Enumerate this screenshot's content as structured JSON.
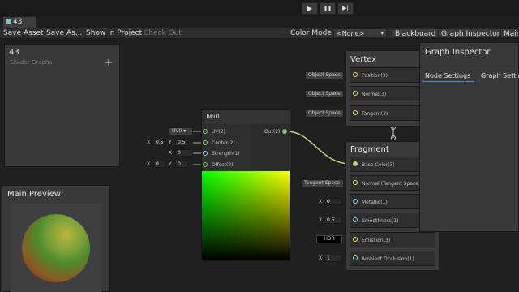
{
  "window": {
    "tab_title": "43"
  },
  "playbar": {
    "play": "▶",
    "pause": "❚❚",
    "step": "▶|"
  },
  "toolbar": {
    "save_asset": "Save Asset",
    "save_as": "Save As...",
    "show_in_project": "Show In Project",
    "check_out": "Check Out",
    "color_mode_label": "Color Mode",
    "color_mode_value": "<None>",
    "blackboard": "Blackboard",
    "graph_inspector": "Graph Inspector",
    "main": "Main"
  },
  "blackboard": {
    "title": "43",
    "subtitle": "Shader Graphs",
    "add": "+"
  },
  "main_preview": {
    "title": "Main Preview"
  },
  "twirl_node": {
    "title": "Twirl",
    "inputs": [
      "UV(2)",
      "Center(2)",
      "Strength(1)",
      "Offset(2)"
    ],
    "output": "Out(2)",
    "uv_value": "UV0 ▾",
    "center": {
      "x_label": "X",
      "x": "0.5",
      "y_label": "Y",
      "y": "0.5"
    },
    "strength": {
      "x_label": "X",
      "x": "0"
    },
    "offset": {
      "x_label": "X",
      "x": "0",
      "y_label": "Y",
      "y": "0"
    }
  },
  "vertex": {
    "title": "Vertex",
    "ports": [
      "Position(3)",
      "Normal(3)",
      "Tangent(3)"
    ],
    "inputs": [
      "Object Space",
      "Object Space",
      "Object Space"
    ]
  },
  "fragment": {
    "title": "Fragment",
    "ports": [
      "Base Color(3)",
      "Normal (Tangent Space)(3)",
      "Metallic(1)",
      "Smoothness(1)",
      "Emission(3)",
      "Ambient Occlusion(1)"
    ],
    "normal_input": "Tangent Space",
    "metallic": {
      "label": "X",
      "value": "0"
    },
    "smoothness": {
      "label": "X",
      "value": "0.5"
    },
    "emission": "HDR",
    "ao": {
      "label": "X",
      "value": "1"
    }
  },
  "graph_inspector": {
    "title": "Graph Inspector",
    "tabs": [
      "Node Settings",
      "Graph Settings"
    ]
  }
}
